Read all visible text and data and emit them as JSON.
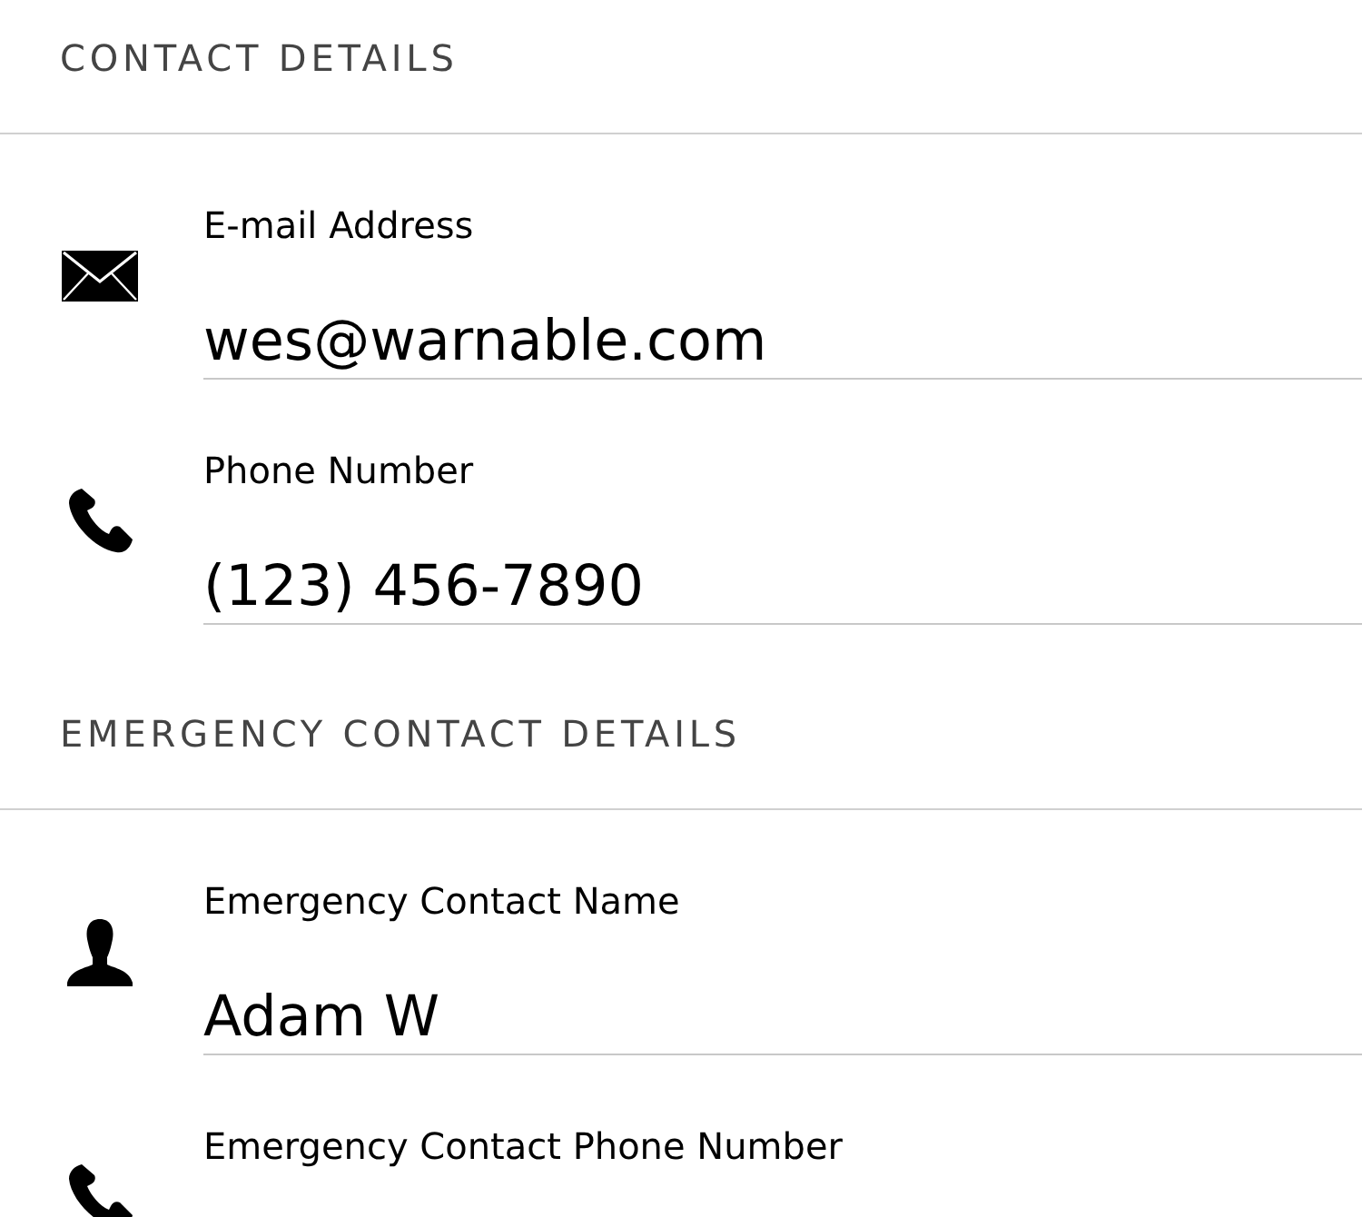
{
  "sections": [
    {
      "title": "CONTACT DETAILS",
      "fields": [
        {
          "kind": "email",
          "label": "E-mail Address",
          "value": "wes@warnable.com"
        },
        {
          "kind": "phone",
          "label": "Phone Number",
          "value": "(123) 456-7890"
        }
      ]
    },
    {
      "title": "EMERGENCY CONTACT DETAILS",
      "fields": [
        {
          "kind": "person",
          "label": "Emergency Contact Name",
          "value": "Adam W"
        },
        {
          "kind": "phone",
          "label": "Emergency Contact Phone Number"
        }
      ]
    }
  ]
}
